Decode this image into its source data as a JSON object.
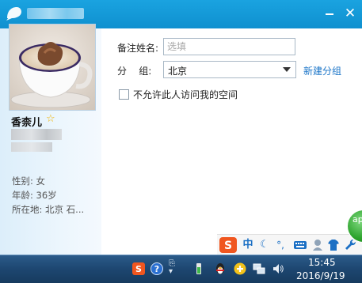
{
  "window": {
    "title": "",
    "minimize_icon": "minimize-icon",
    "close_icon": "close-icon"
  },
  "profile": {
    "nickname": "香柰儿",
    "gender": "性别: 女",
    "age": "年龄: 36岁",
    "location": "所在地: 北京  石..."
  },
  "form": {
    "remark_label": "备注姓名:",
    "remark_placeholder": "选填",
    "remark_value": "",
    "group_label": "分    组:",
    "group_value": "北京",
    "new_group_link": "新建分组",
    "no_space_access_label": "不允许此人访问我的空间",
    "no_space_access_checked": false
  },
  "ime_toolbar": {
    "chinese_mode": "中",
    "moon_icon": "moon-icon",
    "punct": "°,",
    "keyboard_icon": "keyboard-icon",
    "user_icon": "user-icon",
    "shirt_icon": "shirt-icon",
    "wrench_icon": "wrench-icon"
  },
  "taskbar": {
    "time": "15:45",
    "date": "2016/9/19"
  }
}
